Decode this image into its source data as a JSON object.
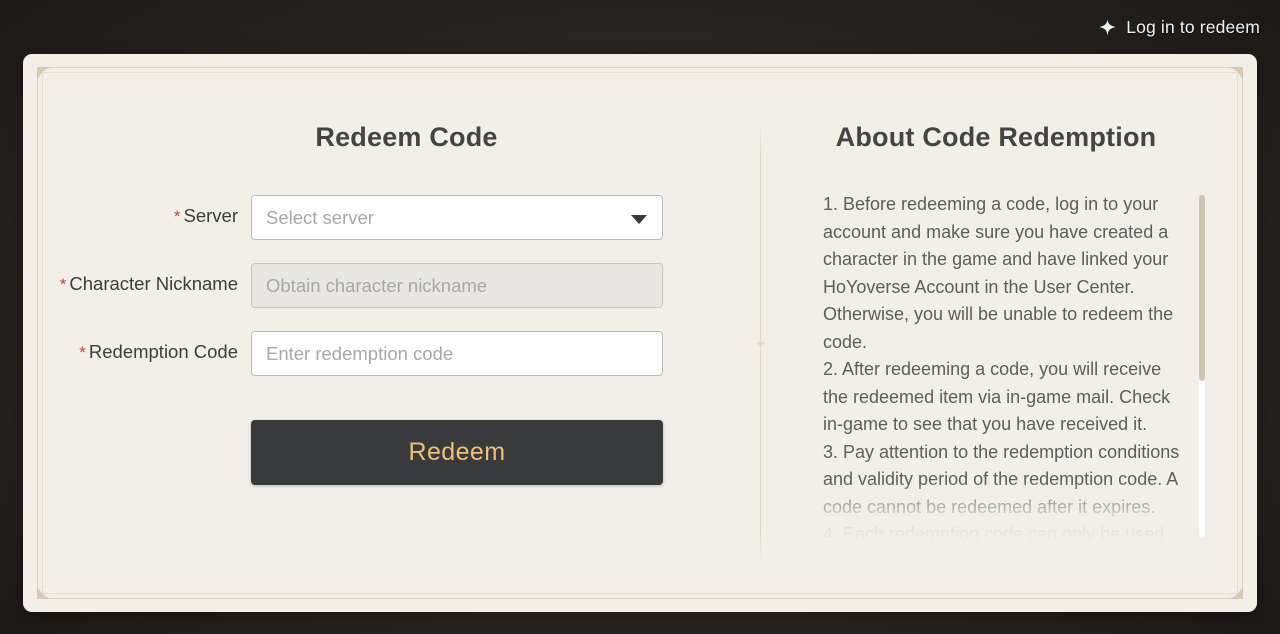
{
  "topbar": {
    "login_label": "Log in to redeem",
    "sparkle_icon": "sparkle-icon"
  },
  "left_panel": {
    "title": "Redeem Code",
    "fields": [
      {
        "label": "Server",
        "required_marker": "*",
        "placeholder": "Select server",
        "value": "",
        "type": "select",
        "disabled": false,
        "icon": "chevron-down-icon"
      },
      {
        "label": "Character Nickname",
        "required_marker": "*",
        "placeholder": "Obtain character nickname",
        "value": "",
        "type": "text",
        "disabled": true
      },
      {
        "label": "Redemption Code",
        "required_marker": "*",
        "placeholder": "Enter redemption code",
        "value": "",
        "type": "text",
        "disabled": false
      }
    ],
    "submit_label": "Redeem"
  },
  "right_panel": {
    "title": "About Code Redemption",
    "items": [
      "1. Before redeeming a code, log in to your account and make sure you have created a character in the game and have linked your HoYoverse Account in the User Center. Otherwise, you will be unable to redeem the code.",
      "2. After redeeming a code, you will receive the redeemed item via in-game mail. Check in-game to see that you have received it.",
      "3. Pay attention to the redemption conditions and validity period of the redemption code. A code cannot be redeemed after it expires.",
      "4. Each redemption code can only be used"
    ]
  },
  "colors": {
    "card_background": "#f2efe9",
    "button_background": "#383a3c",
    "button_text": "#eec07a",
    "required_star": "#c0453a",
    "ornament": "#d8cab6",
    "scrollbar_thumb": "#cfc3b2",
    "heading_text": "#444444",
    "body_text": "#5d5d5d"
  }
}
